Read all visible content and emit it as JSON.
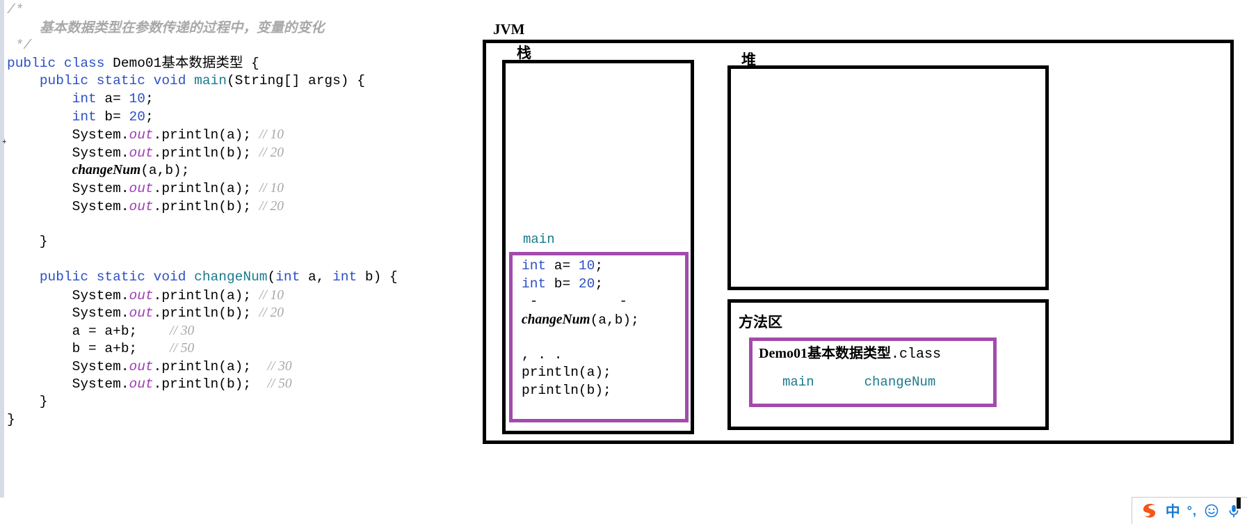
{
  "code": {
    "lines": [
      {
        "id": "l1",
        "tokens": [
          {
            "t": "/*",
            "c": "blkcmt"
          }
        ]
      },
      {
        "id": "l2",
        "tokens": [
          {
            "t": "    ",
            "c": "plain"
          },
          {
            "t": "基本数据类型在参数传递的过程中，变量的变化",
            "c": "blkcmt-cn"
          }
        ]
      },
      {
        "id": "l3",
        "tokens": [
          {
            "t": " */",
            "c": "blkcmt"
          }
        ]
      },
      {
        "id": "l4",
        "tokens": [
          {
            "t": "public class ",
            "c": "kw"
          },
          {
            "t": "Demo01基本数据类型",
            "c": "cls"
          },
          {
            "t": " {",
            "c": "plain"
          }
        ]
      },
      {
        "id": "l5",
        "tokens": [
          {
            "t": "    ",
            "c": "plain"
          },
          {
            "t": "public static void ",
            "c": "kw"
          },
          {
            "t": "main",
            "c": "meth"
          },
          {
            "t": "(String[] args) {",
            "c": "plain"
          }
        ]
      },
      {
        "id": "l6",
        "tokens": [
          {
            "t": "        ",
            "c": "plain"
          },
          {
            "t": "int",
            "c": "kw"
          },
          {
            "t": " a= ",
            "c": "plain"
          },
          {
            "t": "10",
            "c": "num"
          },
          {
            "t": ";",
            "c": "plain"
          }
        ]
      },
      {
        "id": "l7",
        "tokens": [
          {
            "t": "        ",
            "c": "plain"
          },
          {
            "t": "int",
            "c": "kw"
          },
          {
            "t": " b= ",
            "c": "plain"
          },
          {
            "t": "20",
            "c": "num"
          },
          {
            "t": ";",
            "c": "plain"
          }
        ]
      },
      {
        "id": "l8",
        "tokens": [
          {
            "t": "        System.",
            "c": "plain"
          },
          {
            "t": "out",
            "c": "outf"
          },
          {
            "t": ".println(a); ",
            "c": "plain"
          },
          {
            "t": "// 10",
            "c": "cmt"
          }
        ]
      },
      {
        "id": "l9",
        "tokens": [
          {
            "t": "        System.",
            "c": "plain"
          },
          {
            "t": "out",
            "c": "outf"
          },
          {
            "t": ".println(b); ",
            "c": "plain"
          },
          {
            "t": "// 20",
            "c": "cmt"
          }
        ]
      },
      {
        "id": "l10",
        "tokens": [
          {
            "t": "        ",
            "c": "plain"
          },
          {
            "t": "changeNum",
            "c": "mi"
          },
          {
            "t": "(a,b);",
            "c": "plain"
          }
        ]
      },
      {
        "id": "l11",
        "tokens": [
          {
            "t": "        System.",
            "c": "plain"
          },
          {
            "t": "out",
            "c": "outf"
          },
          {
            "t": ".println(a); ",
            "c": "plain"
          },
          {
            "t": "// 10",
            "c": "cmt"
          }
        ]
      },
      {
        "id": "l12",
        "tokens": [
          {
            "t": "        System.",
            "c": "plain"
          },
          {
            "t": "out",
            "c": "outf"
          },
          {
            "t": ".println(b); ",
            "c": "plain"
          },
          {
            "t": "// 20",
            "c": "cmt"
          }
        ]
      },
      {
        "id": "l13",
        "tokens": [
          {
            "t": "",
            "c": "plain"
          }
        ]
      },
      {
        "id": "l14",
        "tokens": [
          {
            "t": "    }",
            "c": "plain"
          }
        ]
      },
      {
        "id": "l15",
        "tokens": [
          {
            "t": "",
            "c": "plain"
          }
        ]
      },
      {
        "id": "l16",
        "tokens": [
          {
            "t": "    ",
            "c": "plain"
          },
          {
            "t": "public static void ",
            "c": "kw"
          },
          {
            "t": "changeNum",
            "c": "meth"
          },
          {
            "t": "(",
            "c": "plain"
          },
          {
            "t": "int",
            "c": "kw"
          },
          {
            "t": " a, ",
            "c": "plain"
          },
          {
            "t": "int",
            "c": "kw"
          },
          {
            "t": " b) {",
            "c": "plain"
          }
        ]
      },
      {
        "id": "l17",
        "tokens": [
          {
            "t": "        System.",
            "c": "plain"
          },
          {
            "t": "out",
            "c": "outf"
          },
          {
            "t": ".println(a); ",
            "c": "plain"
          },
          {
            "t": "// 10",
            "c": "cmt"
          }
        ]
      },
      {
        "id": "l18",
        "tokens": [
          {
            "t": "        System.",
            "c": "plain"
          },
          {
            "t": "out",
            "c": "outf"
          },
          {
            "t": ".println(b); ",
            "c": "plain"
          },
          {
            "t": "// 20",
            "c": "cmt"
          }
        ]
      },
      {
        "id": "l19",
        "tokens": [
          {
            "t": "        a = a+b;    ",
            "c": "plain"
          },
          {
            "t": "// 30",
            "c": "cmt"
          }
        ]
      },
      {
        "id": "l20",
        "tokens": [
          {
            "t": "        b = a+b;    ",
            "c": "plain"
          },
          {
            "t": "// 50",
            "c": "cmt"
          }
        ]
      },
      {
        "id": "l21",
        "tokens": [
          {
            "t": "        System.",
            "c": "plain"
          },
          {
            "t": "out",
            "c": "outf"
          },
          {
            "t": ".println(a);  ",
            "c": "plain"
          },
          {
            "t": "// 30",
            "c": "cmt"
          }
        ]
      },
      {
        "id": "l22",
        "tokens": [
          {
            "t": "        System.",
            "c": "plain"
          },
          {
            "t": "out",
            "c": "outf"
          },
          {
            "t": ".println(b);  ",
            "c": "plain"
          },
          {
            "t": "// 50",
            "c": "cmt"
          }
        ]
      },
      {
        "id": "l23",
        "tokens": [
          {
            "t": "    }",
            "c": "plain"
          }
        ]
      },
      {
        "id": "l24",
        "tokens": [
          {
            "t": "}",
            "c": "plain"
          }
        ]
      }
    ]
  },
  "diagram": {
    "jvm_label": "JVM",
    "stack_label": "栈",
    "heap_label": "堆",
    "method_area_label": "方法区",
    "stack_frame_name": "main",
    "frame_lines": [
      {
        "id": "f1",
        "tokens": [
          {
            "t": "int",
            "c": "kw"
          },
          {
            "t": " a= ",
            "c": "plain"
          },
          {
            "t": "10",
            "c": "num"
          },
          {
            "t": ";",
            "c": "plain"
          }
        ]
      },
      {
        "id": "f2",
        "tokens": [
          {
            "t": "int",
            "c": "kw"
          },
          {
            "t": " b= ",
            "c": "plain"
          },
          {
            "t": "20",
            "c": "num"
          },
          {
            "t": ";",
            "c": "plain"
          }
        ]
      },
      {
        "id": "f3",
        "tokens": [
          {
            "t": " -          -",
            "c": "plain"
          }
        ]
      },
      {
        "id": "f4",
        "tokens": [
          {
            "t": "changeNum",
            "c": "mi"
          },
          {
            "t": "(a,b);",
            "c": "plain"
          }
        ]
      },
      {
        "id": "f5",
        "tokens": [
          {
            "t": "",
            "c": "plain"
          }
        ]
      },
      {
        "id": "f6",
        "tokens": [
          {
            "t": ", . .",
            "c": "plain"
          }
        ]
      },
      {
        "id": "f7",
        "tokens": [
          {
            "t": "println(a);",
            "c": "plain"
          }
        ]
      },
      {
        "id": "f8",
        "tokens": [
          {
            "t": "println(b);",
            "c": "plain"
          }
        ]
      }
    ],
    "class_file_name_cn": "Demo01基本数据类型",
    "class_file_suffix": ".class",
    "class_methods": [
      "main",
      "changeNum"
    ]
  },
  "colors": {
    "keyword_blue": "#2b50c8",
    "method_teal": "#1a7a8c",
    "comment_gray": "#a8a8a8",
    "field_purple": "#a03cb4",
    "box_black": "#000000",
    "box_purple": "#a24bab",
    "ime_blue": "#1779d6",
    "sogou_orange": "#f4561a"
  },
  "ime": {
    "logo": "sogou-logo-icon",
    "language_label": "中",
    "punctuation_label": "°,",
    "emoji_icon": "smiley-icon",
    "mic_icon": "microphone-icon"
  }
}
